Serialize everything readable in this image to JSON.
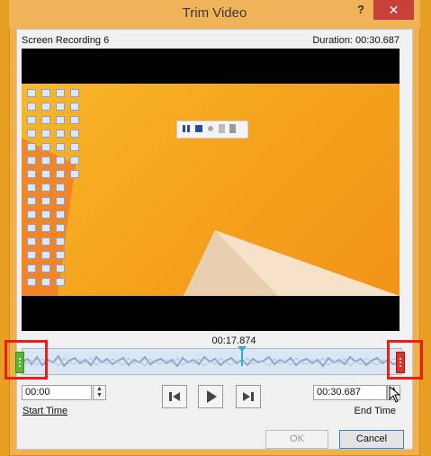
{
  "window": {
    "title": "Trim Video",
    "help_label": "?",
    "close_label": "✕"
  },
  "video": {
    "name": "Screen Recording 6",
    "duration": "Duration: 00:30.687"
  },
  "timeline": {
    "current_time": "00:17.874"
  },
  "trim": {
    "start_time": "00:00",
    "end_time": "00:30.687",
    "start_label": "Start Time",
    "end_label": "End Time"
  },
  "buttons": {
    "ok": "OK",
    "cancel": "Cancel"
  },
  "colors": {
    "accent": "#2ab3c4",
    "start_handle": "#5bb33a",
    "end_handle": "#d8342c",
    "highlight": "#e8201c"
  }
}
